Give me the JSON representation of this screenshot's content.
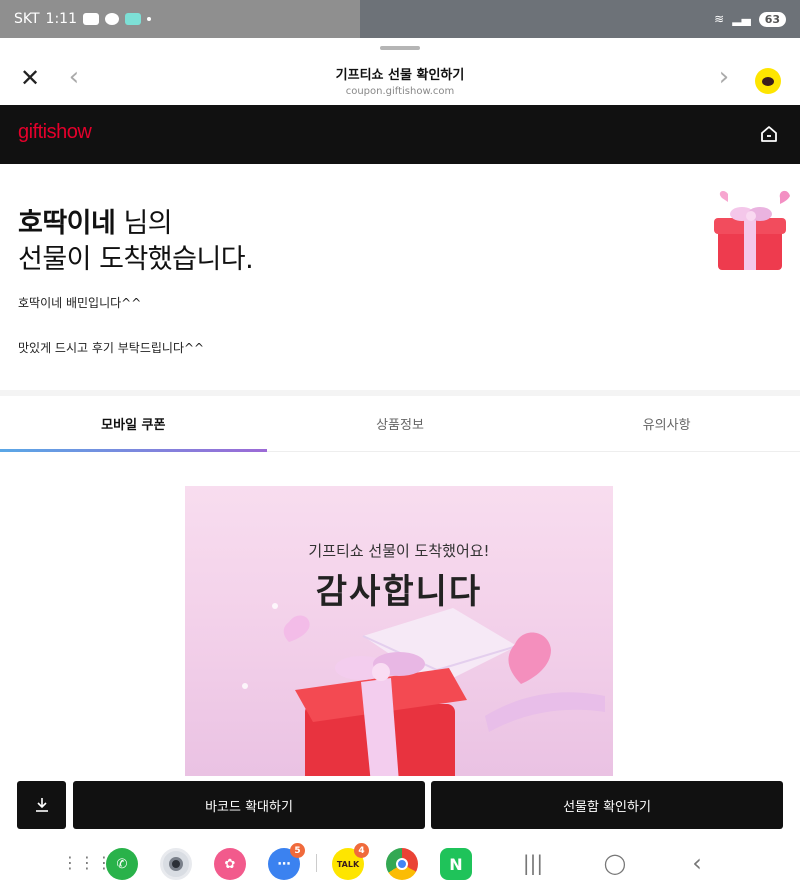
{
  "status_bar": {
    "carrier": "SKT",
    "time": "1:11",
    "battery": "63"
  },
  "browser": {
    "title": "기프티쇼 선물 확인하기",
    "url": "coupon.giftishow.com"
  },
  "brand": {
    "logo_text": "giftishow"
  },
  "greeting": {
    "sender": "호딱이네",
    "suffix": " 님의",
    "line2": "선물이 도착했습니다.",
    "message1": "호딱이네 배민입니다^^",
    "message2": "맛있게 드시고 후기 부탁드립니다^^"
  },
  "tabs": [
    {
      "label": "모바일 쿠폰",
      "active": true
    },
    {
      "label": "상품정보",
      "active": false
    },
    {
      "label": "유의사항",
      "active": false
    }
  ],
  "coupon": {
    "subtitle": "기프티쇼 선물이 도착했어요!",
    "title": "감사합니다"
  },
  "actions": {
    "barcode_label": "바코드 확대하기",
    "giftbox_label": "선물함 확인하기"
  },
  "dock": {
    "messages_badge": "5",
    "kakaotalk_badge": "4",
    "kakaotalk_label": "TALK",
    "naver_label": "N"
  },
  "colors": {
    "brand_red": "#e4002b",
    "kakao_yellow": "#fee500",
    "dark_bar": "#111111"
  }
}
